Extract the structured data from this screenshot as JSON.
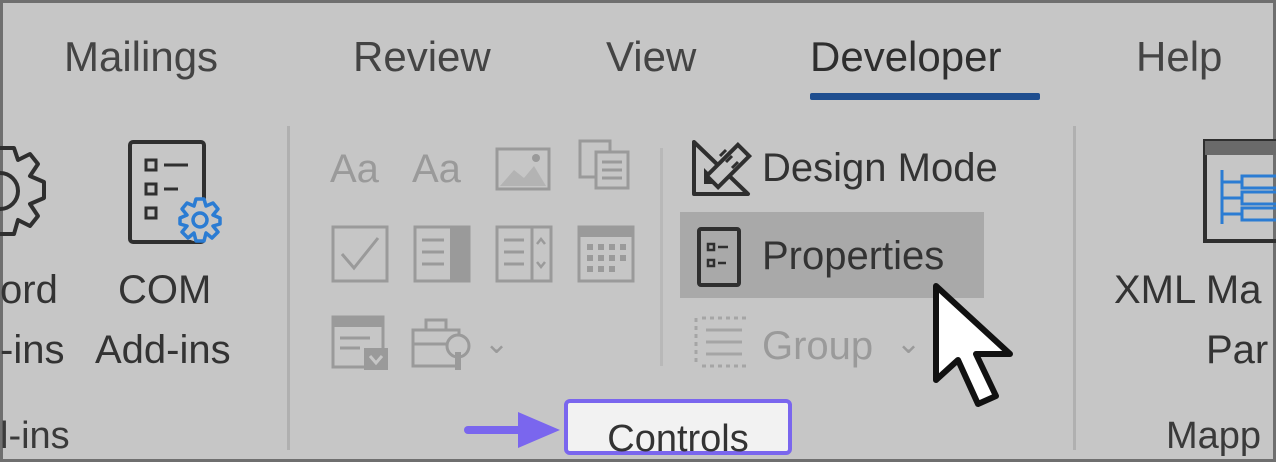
{
  "tabs": [
    {
      "label": "Mailings",
      "active": false
    },
    {
      "label": "Review",
      "active": false
    },
    {
      "label": "View",
      "active": false
    },
    {
      "label": "Developer",
      "active": true
    },
    {
      "label": "Help",
      "active": false
    }
  ],
  "addins_group": {
    "word_addins_line1": "ord",
    "word_addins_line2": "-ins",
    "com_addins_line1": "COM",
    "com_addins_line2": "Add-ins",
    "group_label": "l-ins"
  },
  "controls_group": {
    "design_mode_label": "Design Mode",
    "properties_label": "Properties",
    "group_button_label": "Group",
    "group_label": "Controls"
  },
  "mapping_group": {
    "xml_line1": "XML Ma",
    "xml_line2": "Par",
    "group_label": "Mapp"
  },
  "colors": {
    "background": "#c6c6c6",
    "active_underline": "#1f4e8f",
    "highlight_border": "#7a66ee",
    "arrow": "#7a66ee",
    "icon_blue": "#2b7cd3"
  }
}
